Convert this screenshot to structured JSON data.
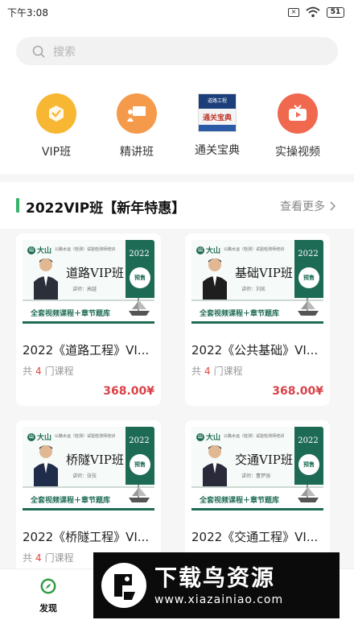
{
  "status_bar": {
    "time": "下午3:08",
    "battery": "51",
    "sim_label": "×"
  },
  "search": {
    "placeholder": "搜索"
  },
  "quick_nav": [
    {
      "label": "VIP班",
      "icon": "vip-badge-icon",
      "color": "#f7b733"
    },
    {
      "label": "精讲班",
      "icon": "teacher-board-icon",
      "color": "#f59a4a"
    },
    {
      "label": "通关宝典",
      "icon": "book-cover-icon",
      "book_top": "道路工程",
      "book_mid": "通关宝典"
    },
    {
      "label": "实操视频",
      "icon": "video-play-icon",
      "color": "#f0694f"
    }
  ],
  "section": {
    "title": "2022VIP班【新年特惠】",
    "more_label": "查看更多"
  },
  "cards": [
    {
      "title": "2022《道路工程》VI...",
      "banner_title": "道路VIP班",
      "teacher": "讲师：高越",
      "count": "4",
      "price": "368.00¥"
    },
    {
      "title": "2022《公共基础》VI...",
      "banner_title": "基础VIP班",
      "teacher": "讲师：刘凯",
      "count": "4",
      "price": "368.00¥"
    },
    {
      "title": "2022《桥隧工程》VI...",
      "banner_title": "桥隧VIP班",
      "teacher": "讲师：张弦",
      "count": "4",
      "price": ""
    },
    {
      "title": "2022《交通工程》VI...",
      "banner_title": "交通VIP班",
      "teacher": "讲师：曹梦强",
      "count": "",
      "price": ""
    }
  ],
  "card_common": {
    "count_prefix": "共",
    "count_suffix": "门课程",
    "banner_year": "2022",
    "badge": "预售",
    "slogan": "全套视频课程＋章节题库",
    "brand": "大山",
    "banner_sub": "公路水运（检测）试验检测师培训"
  },
  "bottom_nav": {
    "discover_label": "发现"
  },
  "watermark": {
    "title": "下载鸟资源",
    "url": "www.xiazainiao.com"
  },
  "colors": {
    "accent_green": "#35b36b",
    "banner_green": "#1e6b55",
    "price_red": "#d8434a"
  }
}
